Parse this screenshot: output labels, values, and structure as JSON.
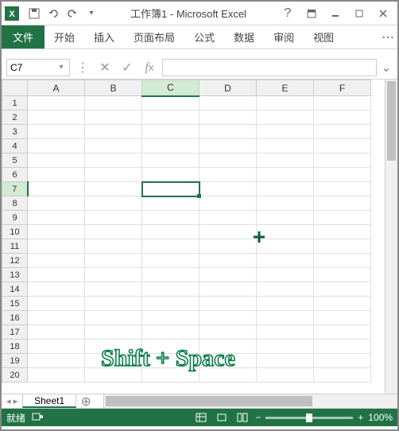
{
  "title": "工作簿1 - Microsoft Excel",
  "ribbon": {
    "file": "文件",
    "tabs": [
      "开始",
      "插入",
      "页面布局",
      "公式",
      "数据",
      "审阅",
      "视图"
    ]
  },
  "namebox": "C7",
  "formula": "",
  "columns": [
    "A",
    "B",
    "C",
    "D",
    "E",
    "F"
  ],
  "active_col": "C",
  "rows": [
    1,
    2,
    3,
    4,
    5,
    6,
    7,
    8,
    9,
    10,
    11,
    12,
    13,
    14,
    15,
    16,
    17,
    18,
    19,
    20
  ],
  "active_row": 7,
  "sheet": "Sheet1",
  "status": "就绪",
  "zoom": "100%",
  "overlay": "Shift + Space"
}
